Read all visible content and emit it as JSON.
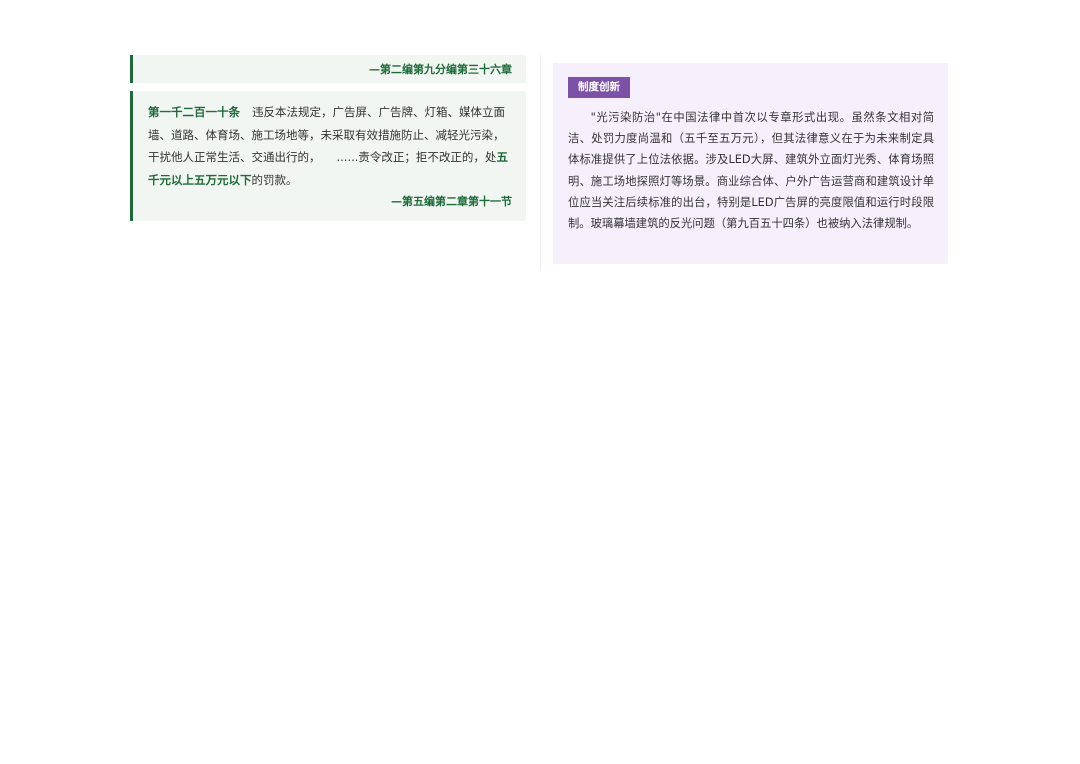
{
  "left": {
    "source_top": "—第二编第九分编第三十六章",
    "article": {
      "number": "第一千二百一十条",
      "text_part1": "违反本法规定，广告屏、广告牌、灯箱、媒体立面墙、道路、体育场、施工场地等，未采取有效措施防止、减轻光污染，干扰他人正常生活、交通出行的，",
      "text_ellipsis": "......责令改正；拒不改正的，处",
      "highlight": "五千元以上五万元以下",
      "text_end": "的罚款。"
    },
    "source_bottom": "—第五编第二章第十一节"
  },
  "right": {
    "badge": "制度创新",
    "paragraph": "\"光污染防治\"在中国法律中首次以专章形式出现。虽然条文相对简洁、处罚力度尚温和（五千至五万元），但其法律意义在于为未来制定具体标准提供了上位法依据。涉及LED大屏、建筑外立面灯光秀、体育场照明、施工场地探照灯等场景。商业综合体、户外广告运营商和建筑设计单位应当关注后续标准的出台，特别是LED广告屏的亮度限值和运行时段限制。玻璃幕墙建筑的反光问题（第九百五十四条）也被纳入法律规制。"
  },
  "colors": {
    "green_accent": "#1e6b3a",
    "green_bg": "#f2f6f2",
    "purple_badge": "#7b52a8",
    "purple_bg": "#f6f0fd"
  }
}
